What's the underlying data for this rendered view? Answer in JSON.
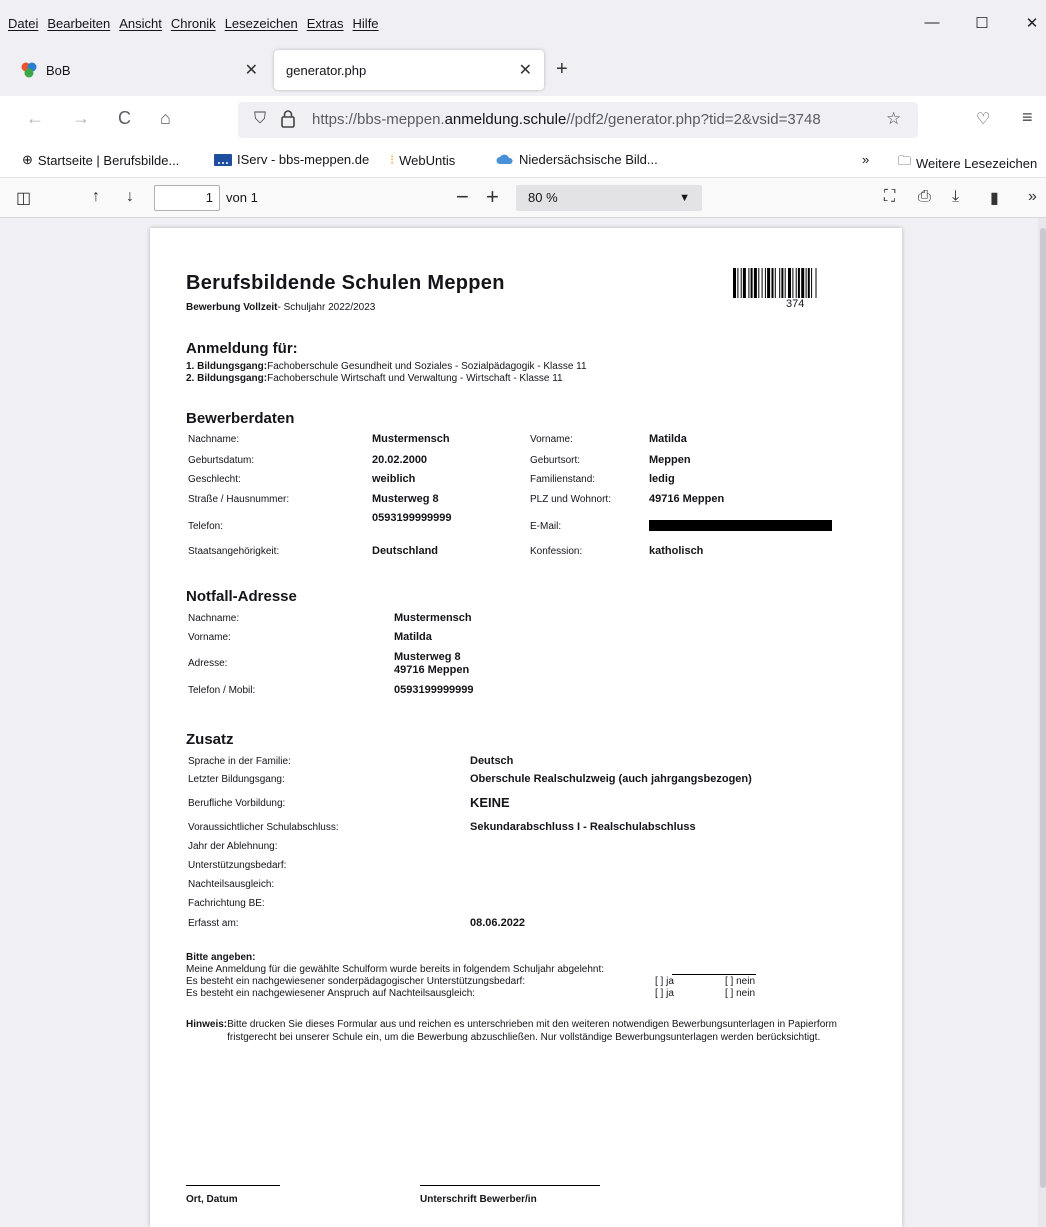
{
  "menu": [
    "Datei",
    "Bearbeiten",
    "Ansicht",
    "Chronik",
    "Lesezeichen",
    "Extras",
    "Hilfe"
  ],
  "window_controls": {
    "minimize": "—",
    "maximize": "☐",
    "close": "✕"
  },
  "tabs": [
    {
      "title": "BoB",
      "close": "✕"
    },
    {
      "title": "generator.php",
      "close": "✕"
    }
  ],
  "new_tab": "+",
  "nav": {
    "back": "←",
    "forward": "→",
    "reload": "C",
    "home": "⌂"
  },
  "url": {
    "prefix": "https://bbs-meppen.",
    "domain": "anmeldung.schule",
    "path": "//pdf2/generator.php?tid=2&vsid=3748"
  },
  "bookmarks": {
    "items": [
      "Startseite | Berufsbilde...",
      "IServ - bbs-meppen.de",
      "WebUntis",
      "Niedersächsische Bild..."
    ],
    "more": "»",
    "folder": "Weitere Lesezeichen"
  },
  "pdf_toolbar": {
    "page_current": "1",
    "page_of": "von 1",
    "zoom": "80 %"
  },
  "doc": {
    "school": "Berufsbildende Schulen Meppen",
    "subtitle_bold": "Bewerbung Vollzeit",
    "subtitle_rest": " - Schuljahr 2022/2023",
    "barcode_number": "374",
    "anmeldung": {
      "title": "Anmeldung für:",
      "lines": [
        {
          "label": "1. Bildungsgang:",
          "text": " Fachoberschule Gesundheit und Soziales - Sozialpädagogik - Klasse 11"
        },
        {
          "label": "2. Bildungsgang:",
          "text": " Fachoberschule Wirtschaft und Verwaltung - Wirtschaft - Klasse 11"
        }
      ]
    },
    "bewerber": {
      "title": "Bewerberdaten",
      "nachname_l": "Nachname:",
      "nachname_v": "Mustermensch",
      "vorname_l": "Vorname:",
      "vorname_v": "Matilda",
      "geburtsdatum_l": "Geburtsdatum:",
      "geburtsdatum_v": "20.02.2000",
      "geburtsort_l": "Geburtsort:",
      "geburtsort_v": "Meppen",
      "geschlecht_l": "Geschlecht:",
      "geschlecht_v": "weiblich",
      "familienstand_l": "Familienstand:",
      "familienstand_v": "ledig",
      "strasse_l": "Straße / Hausnummer:",
      "strasse_v": "Musterweg 8",
      "plz_l": "PLZ und Wohnort:",
      "plz_v": "49716 Meppen",
      "telefon_l": "Telefon:",
      "telefon_v": "0593199999999",
      "email_l": "E-Mail:",
      "staat_l": "Staatsangehörigkeit:",
      "staat_v": "Deutschland",
      "konfession_l": "Konfession:",
      "konfession_v": "katholisch"
    },
    "notfall": {
      "title": "Notfall-Adresse",
      "nachname_l": "Nachname:",
      "nachname_v": "Mustermensch",
      "vorname_l": "Vorname:",
      "vorname_v": "Matilda",
      "adresse_l": "Adresse:",
      "adresse_v1": "Musterweg 8",
      "adresse_v2": "49716 Meppen",
      "telefon_l": "Telefon / Mobil:",
      "telefon_v": "0593199999999"
    },
    "zusatz": {
      "title": "Zusatz",
      "sprache_l": "Sprache in der Familie:",
      "sprache_v": "Deutsch",
      "letzter_l": "Letzter Bildungsgang:",
      "letzter_v": "Oberschule Realschulzweig (auch jahrgangsbezogen)",
      "vorbildung_l": "Berufliche Vorbildung:",
      "vorbildung_v": "KEINE",
      "abschluss_l": "Voraussichtlicher Schulabschluss:",
      "abschluss_v": "Sekundarabschluss I - Realschulabschluss",
      "ablehnung_l": "Jahr der Ablehnung:",
      "unterstuetzung_l": "Unterstützungsbedarf:",
      "nachteil_l": "Nachteilsausgleich:",
      "fachrichtung_l": "Fachrichtung BE:",
      "erfasst_l": "Erfasst am:",
      "erfasst_v": "08.06.2022"
    },
    "angeben": {
      "title": "Bitte angeben:",
      "line1": "Meine Anmeldung für die gewählte Schulform wurde bereits in folgendem Schuljahr abgelehnt:",
      "line2": "Es besteht ein nachgewiesener sonderpädagogischer Unterstützungsbedarf:",
      "line3": "Es besteht ein nachgewiesener Anspruch auf Nachteilsausgleich:",
      "ja": "[  ] ja",
      "nein": "[  ] nein"
    },
    "hinweis": {
      "label": "Hinweis:",
      "text": " Bitte drucken Sie dieses Formular aus und reichen es unterschrieben mit den weiteren notwendigen Bewerbungsunterlagen in Papierform fristgerecht bei unserer Schule ein, um die Bewerbung abzuschließen. Nur vollständige Bewerbungsunterlagen werden berücksichtigt."
    },
    "signature": {
      "ort": "Ort, Datum",
      "unterschrift": "Unterschrift Bewerber/in"
    }
  },
  "colors": {
    "accent": "#0060df",
    "chrome": "#f0f0f4",
    "redaction": "#000000"
  }
}
